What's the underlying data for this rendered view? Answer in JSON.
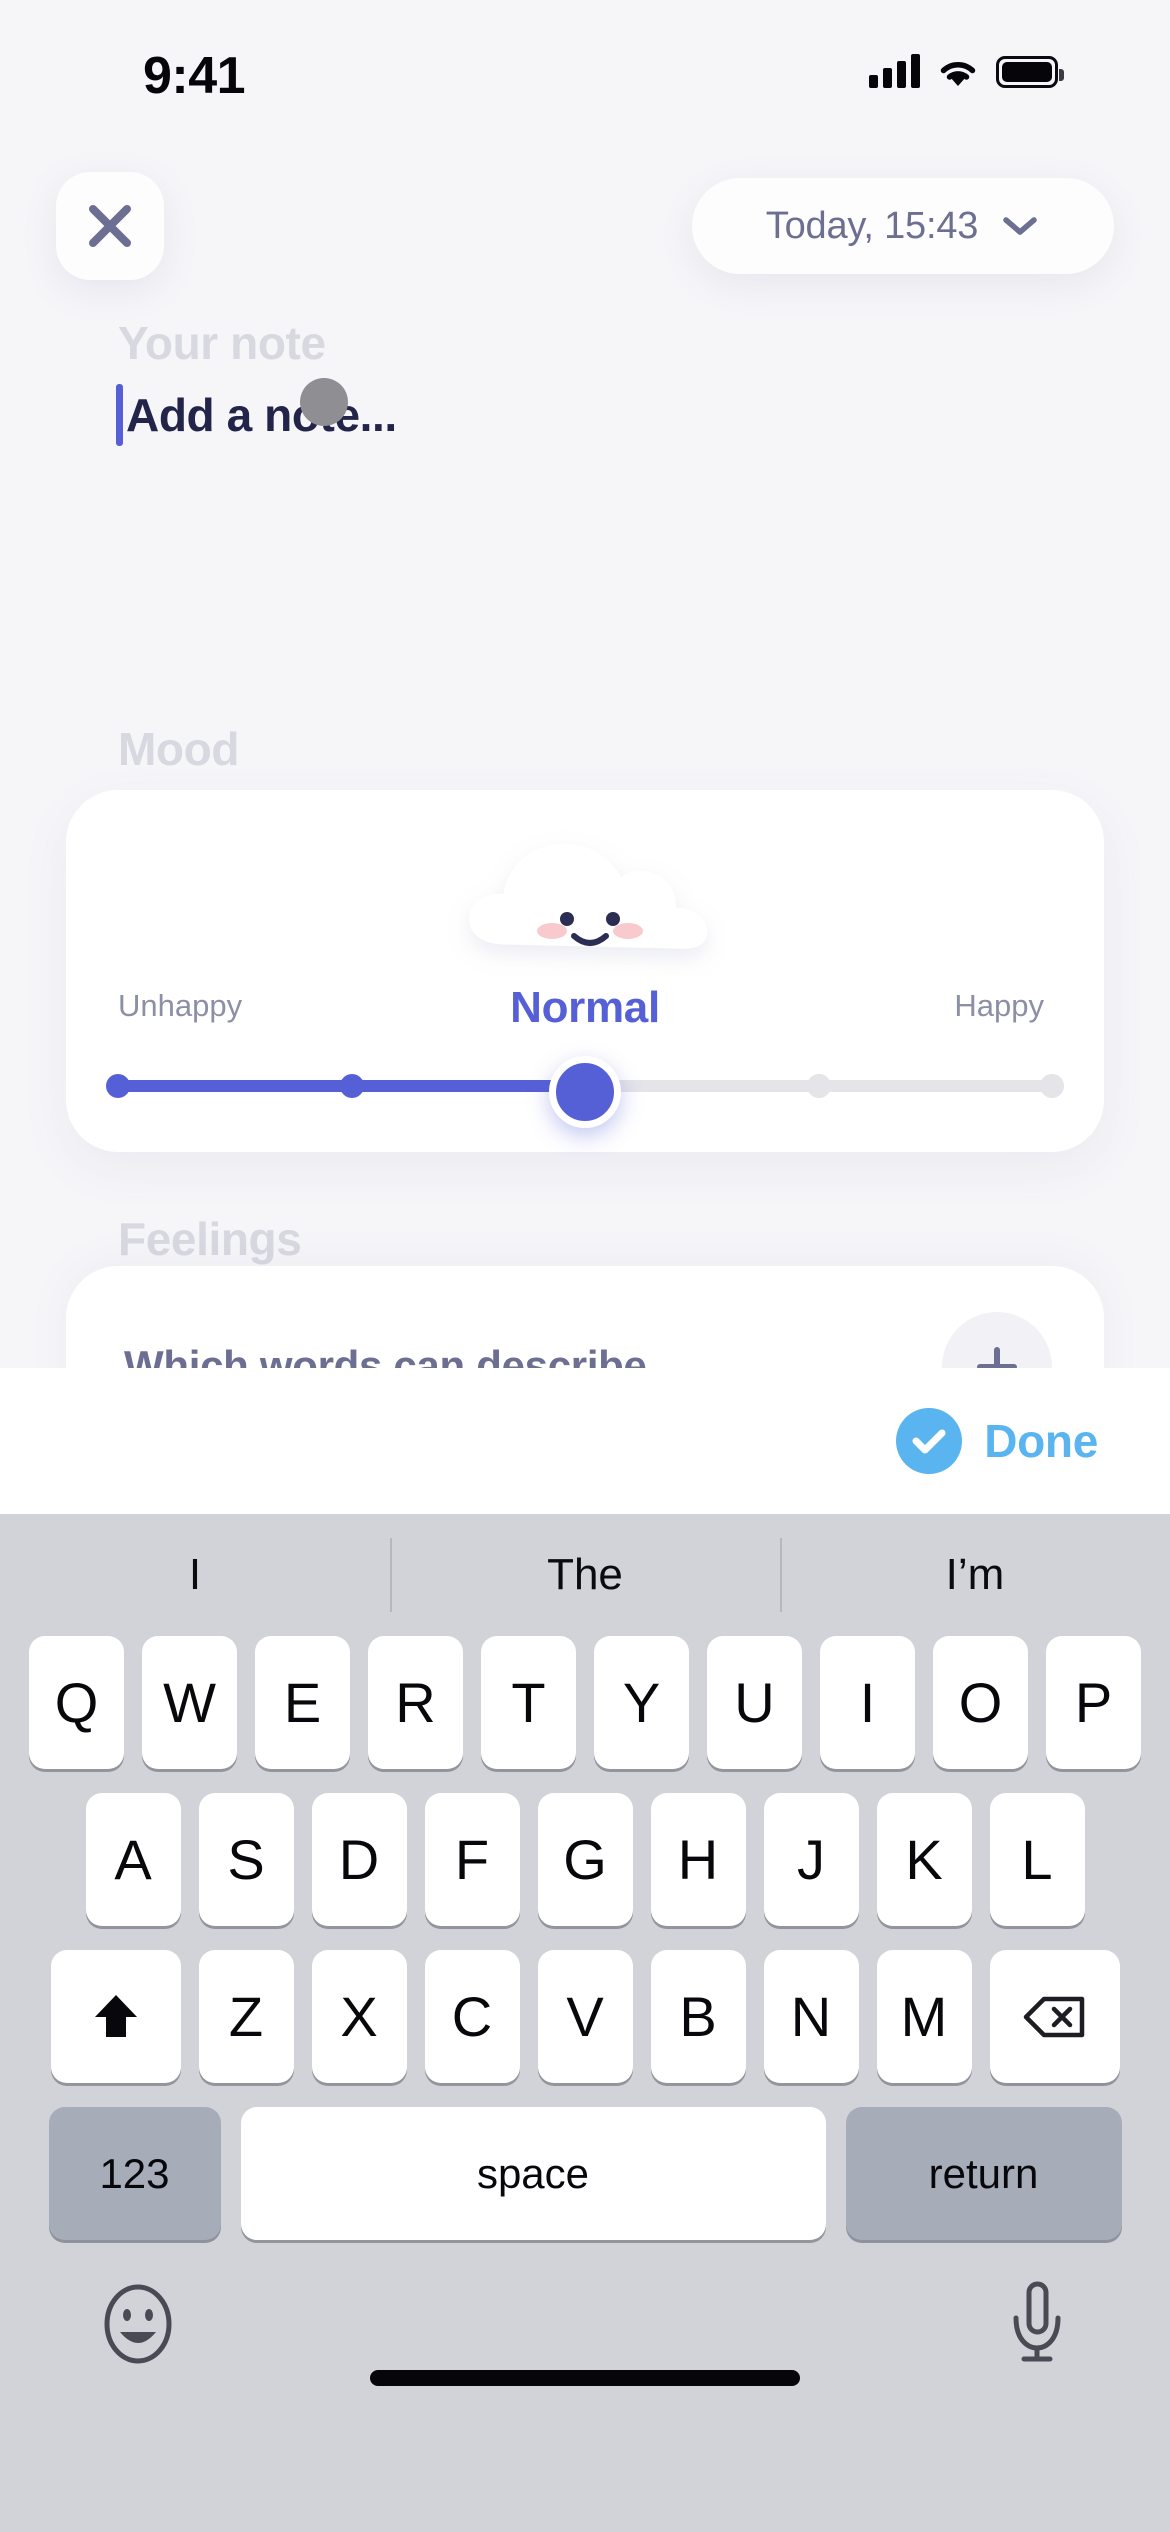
{
  "status_bar": {
    "time": "9:41",
    "signal_icon": "cellular-signal-icon",
    "wifi_icon": "wifi-icon",
    "battery_icon": "battery-icon"
  },
  "header": {
    "close_icon": "close-icon",
    "date_label": "Today, 15:43",
    "date_chevron_icon": "chevron-down-icon"
  },
  "note": {
    "section_label": "Your note",
    "value": "",
    "placeholder": "Add a note...",
    "caret_color": "#5560d6",
    "touch_indicator": "touch-point-indicator"
  },
  "mood": {
    "section_label": "Mood",
    "illustration": "cloud-face-normal-icon",
    "selected_label": "Normal",
    "selected_color": "#5560d6",
    "min_label": "Unhappy",
    "max_label": "Happy",
    "value": 2,
    "min": 0,
    "max": 4,
    "steps": [
      0,
      1,
      2,
      3,
      4
    ],
    "track_active_color": "#5560d6",
    "track_inactive_color": "#e4e4e9"
  },
  "feelings": {
    "section_label": "Feelings",
    "question": "Which words can describe",
    "add_icon": "plus-icon"
  },
  "done_bar": {
    "check_icon": "check-circle-icon",
    "label": "Done",
    "color": "#5ab4f0"
  },
  "keyboard": {
    "suggestions": [
      "I",
      "The",
      "I’m"
    ],
    "row1": [
      "Q",
      "W",
      "E",
      "R",
      "T",
      "Y",
      "U",
      "I",
      "O",
      "P"
    ],
    "row2": [
      "A",
      "S",
      "D",
      "F",
      "G",
      "H",
      "J",
      "K",
      "L"
    ],
    "row3": [
      "Z",
      "X",
      "C",
      "V",
      "B",
      "N",
      "M"
    ],
    "shift_icon": "shift-arrow-icon",
    "backspace_icon": "backspace-icon",
    "numbers_key": "123",
    "space_key": "space",
    "return_key": "return",
    "emoji_icon": "emoji-smiley-icon",
    "mic_icon": "microphone-icon",
    "home_indicator": "home-indicator"
  }
}
